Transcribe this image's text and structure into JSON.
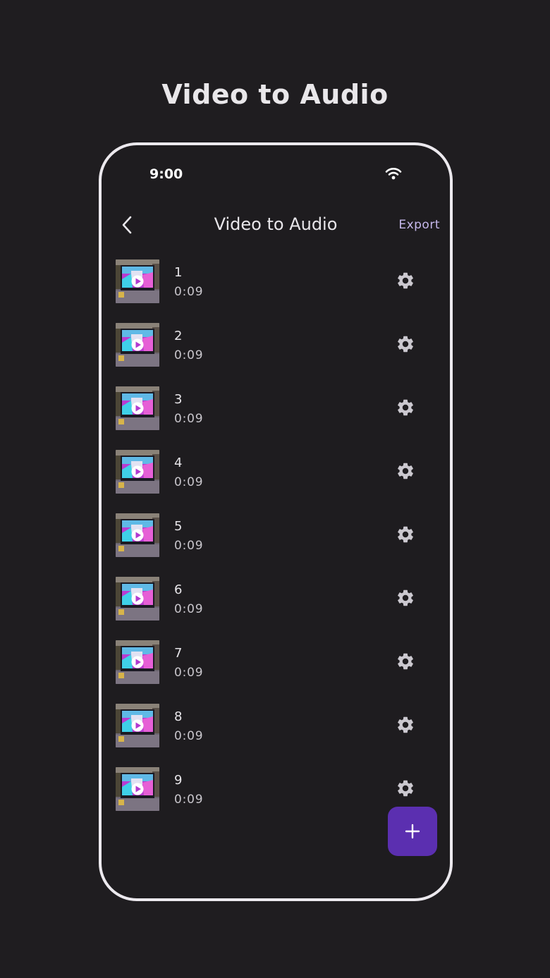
{
  "promo": {
    "title": "Video to Audio"
  },
  "status_bar": {
    "time": "9:00",
    "wifi_icon": "wifi-icon"
  },
  "app_bar": {
    "back_icon": "chevron-left-icon",
    "title": "Video to Audio",
    "export_label": "Export"
  },
  "videos": [
    {
      "title": "1",
      "duration": "0:09"
    },
    {
      "title": "2",
      "duration": "0:09"
    },
    {
      "title": "3",
      "duration": "0:09"
    },
    {
      "title": "4",
      "duration": "0:09"
    },
    {
      "title": "5",
      "duration": "0:09"
    },
    {
      "title": "6",
      "duration": "0:09"
    },
    {
      "title": "7",
      "duration": "0:09"
    },
    {
      "title": "8",
      "duration": "0:09"
    },
    {
      "title": "9",
      "duration": "0:09"
    }
  ],
  "item_icons": {
    "thumbnail_overlay": "play-icon",
    "action": "gear-icon"
  },
  "fab": {
    "icon": "plus-icon"
  },
  "colors": {
    "background": "#1f1d20",
    "accent": "#5b2fb0",
    "export_text": "#c6b8ec",
    "frame": "#ece9ee"
  }
}
